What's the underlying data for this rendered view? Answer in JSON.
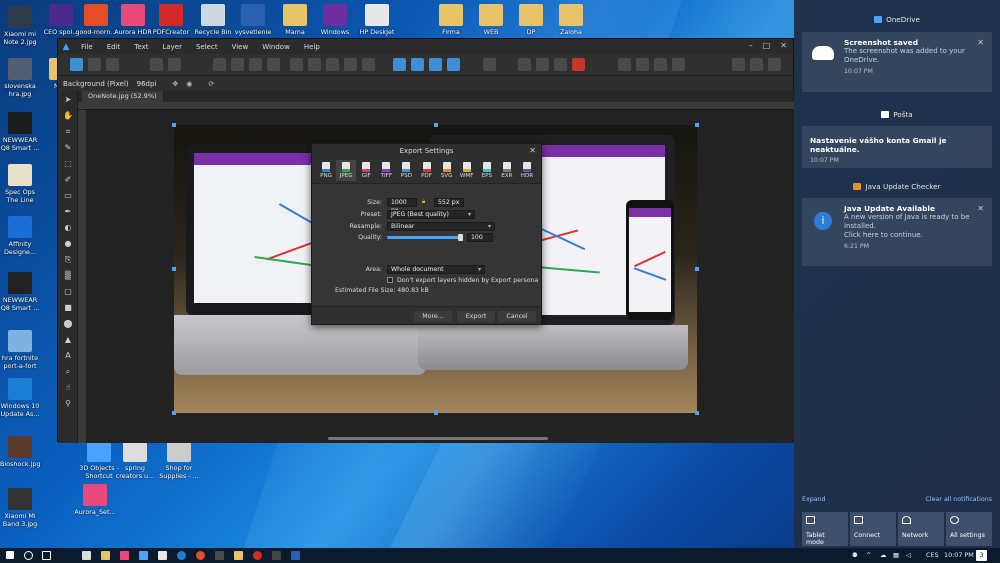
{
  "desktop": {
    "icons": [
      {
        "label": "Xiaomi mi Note 2.jpg",
        "color": "#2d3a4a"
      },
      {
        "label": "slovenska hra.jpg",
        "color": "#506070"
      },
      {
        "label": "NEWWEAR Q8 Smart ...",
        "color": "#1d1d1d"
      },
      {
        "label": "Spec Ops The Line",
        "color": "#e8e0c8"
      },
      {
        "label": "Affinity Designe...",
        "color": "#1a6ed8"
      },
      {
        "label": "NEWWEAR Q8 Smart ...",
        "color": "#222222"
      },
      {
        "label": "hra fortnite port-a-fort",
        "color": "#7fb2e0"
      },
      {
        "label": "Windows 10 Update As...",
        "color": "#1a7fd4"
      },
      {
        "label": "Bioshock.jpg",
        "color": "#5a3a2a"
      },
      {
        "label": "Xiaomi Mi Band 3.jpg",
        "color": "#333333"
      }
    ],
    "top_icons": [
      {
        "label": "CEO spol...",
        "color": "#4a2a8a"
      },
      {
        "label": "good-morn...",
        "color": "#e44d26"
      },
      {
        "label": "Aurora HDR",
        "color": "#e84a7a"
      },
      {
        "label": "PDFCreator",
        "color": "#d42a2a"
      },
      {
        "label": "Recycle Bin",
        "color": "#cfd8e0"
      },
      {
        "label": "vysvetlenie",
        "color": "#2b5fb0"
      },
      {
        "label": "Mama",
        "color": "#e8c36a"
      },
      {
        "label": "Windows",
        "color": "#6b2fa0"
      },
      {
        "label": "HP DeskJet",
        "color": "#e8e8e8"
      },
      {
        "label": "Firma",
        "color": "#e8c36a"
      },
      {
        "label": "WEB",
        "color": "#e8c36a"
      },
      {
        "label": "DP",
        "color": "#e8c36a"
      },
      {
        "label": "Zaloha",
        "color": "#e8c36a"
      }
    ],
    "bottom_icons": [
      {
        "label": "3D Objects - Shortcut",
        "color": "#4aa3ff"
      },
      {
        "label": "spring creators u...",
        "color": "#dddddd"
      },
      {
        "label": "Shop for Supplies - ...",
        "color": "#cccccc"
      },
      {
        "label": "Aurora_Set...",
        "color": "#e84a7a"
      },
      {
        "label": "New",
        "color": "#e8c36a"
      }
    ]
  },
  "app": {
    "menu": [
      "File",
      "Edit",
      "Text",
      "Layer",
      "Select",
      "View",
      "Window",
      "Help"
    ],
    "window_controls": [
      "–",
      "□",
      "✕"
    ],
    "context": {
      "layer": "Background (Pixel)",
      "dpi": "96dpi"
    },
    "tab_title": "OneNote.jpg (52.9%)"
  },
  "export_dialog": {
    "title": "Export Settings",
    "close": "✕",
    "formats": [
      {
        "label": "PNG",
        "color": "#3a7bd5"
      },
      {
        "label": "JPEG",
        "color": "#2fa84f"
      },
      {
        "label": "GIF",
        "color": "#d53a8a"
      },
      {
        "label": "TIFF",
        "color": "#8a3ad5"
      },
      {
        "label": "PSD",
        "color": "#3a9ad5"
      },
      {
        "label": "PDF",
        "color": "#d53a3a"
      },
      {
        "label": "SVG",
        "color": "#e08a2a"
      },
      {
        "label": "WMF",
        "color": "#d5a83a"
      },
      {
        "label": "EPS",
        "color": "#3ac5d5"
      },
      {
        "label": "EXR",
        "color": "#7a7a7a"
      },
      {
        "label": "HDR",
        "color": "#5a5aa0"
      }
    ],
    "selected_format": "JPEG",
    "size_label": "Size:",
    "width": "1000 px",
    "height": "552 px",
    "preset_label": "Preset:",
    "preset": "JPEG (Best quality)",
    "resample_label": "Resample:",
    "resample": "Bilinear",
    "quality_label": "Quality:",
    "quality": "100",
    "quality_fraction": 1.0,
    "area_label": "Area:",
    "area": "Whole document",
    "checkbox_label": "Don't export layers hidden by Export persona",
    "file_size": "Estimated File Size: 480.83 kB",
    "buttons": {
      "more": "More...",
      "export": "Export",
      "cancel": "Cancel"
    }
  },
  "action_center": {
    "groups": [
      {
        "app": "OneDrive",
        "color": "#4aa3ff",
        "title": "Screenshot saved",
        "body": "The screenshot was added to your OneDrive.",
        "time": "10:07 PM"
      },
      {
        "app": "Pošta",
        "color": "#ffffff",
        "title": "Nastavenie vášho konta Gmail je neaktuálne.",
        "body": "",
        "time": "10:07 PM"
      },
      {
        "app": "Java Update Checker",
        "color": "#e8912a",
        "title": "Java Update Available",
        "body": "A new version of Java is ready to be installed.",
        "body2": "Click here to continue.",
        "time": "6:21 PM"
      }
    ],
    "expand": "Expand",
    "clear_all": "Clear all notifications",
    "quick_actions": [
      "Tablet mode",
      "Connect",
      "Network",
      "All settings"
    ]
  },
  "taskbar": {
    "lang": "CES",
    "time": "10:07 PM",
    "notification_count": "3"
  }
}
